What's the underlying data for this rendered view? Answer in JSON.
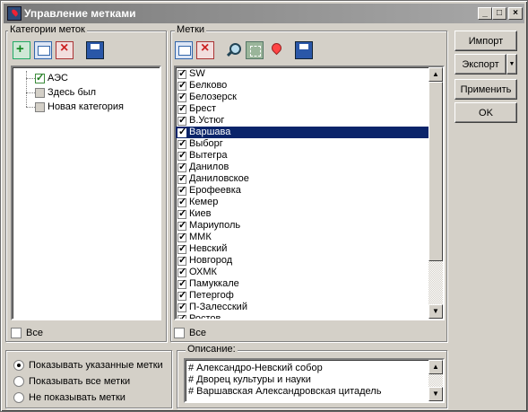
{
  "window": {
    "title": "Управление метками",
    "controls": {
      "minimize": "_",
      "maximize": "□",
      "close": "×"
    }
  },
  "categories_panel": {
    "label": "Категории меток",
    "toolbar": [
      "add-category-icon",
      "edit-category-icon",
      "delete-category-icon",
      "save-icon"
    ],
    "items": [
      {
        "label": "АЭС",
        "checked": true
      },
      {
        "label": "Здесь был",
        "checked": false
      },
      {
        "label": "Новая категория",
        "checked": false
      }
    ],
    "all_label": "Все"
  },
  "marks_panel": {
    "label": "Метки",
    "toolbar": [
      "edit-mark-icon",
      "delete-mark-icon",
      "find-icon",
      "zoom-area-icon",
      "pin-icon",
      "save-icon"
    ],
    "items": [
      {
        "label": "SW"
      },
      {
        "label": "Белково"
      },
      {
        "label": "Белозерск"
      },
      {
        "label": "Брест"
      },
      {
        "label": "В.Устюг"
      },
      {
        "label": "Варшава",
        "selected": true
      },
      {
        "label": "Выборг"
      },
      {
        "label": "Вытегра"
      },
      {
        "label": "Данилов"
      },
      {
        "label": "Даниловское"
      },
      {
        "label": "Ерофеевка"
      },
      {
        "label": "Кемер"
      },
      {
        "label": "Киев"
      },
      {
        "label": "Мариуполь"
      },
      {
        "label": "ММК"
      },
      {
        "label": "Невский"
      },
      {
        "label": "Новгород"
      },
      {
        "label": "ОХМК"
      },
      {
        "label": "Памуккале"
      },
      {
        "label": "Петергоф"
      },
      {
        "label": "П-Залесский"
      },
      {
        "label": "Ростов"
      }
    ],
    "all_label": "Все"
  },
  "buttons": {
    "import": "Импорт",
    "export": "Экспорт",
    "export_arrow": "▼",
    "apply": "Применить",
    "ok": "OK"
  },
  "display_options": [
    {
      "label": "Показывать указанные метки",
      "selected": true
    },
    {
      "label": "Показывать все метки",
      "selected": false
    },
    {
      "label": "Не показывать метки",
      "selected": false
    }
  ],
  "description": {
    "label": "Описание:",
    "lines": [
      "# Александро-Невский собор",
      "# Дворец культуры и науки",
      "# Варшавская Александровская цитадель"
    ]
  },
  "scroll_arrows": {
    "up": "▲",
    "down": "▼"
  }
}
